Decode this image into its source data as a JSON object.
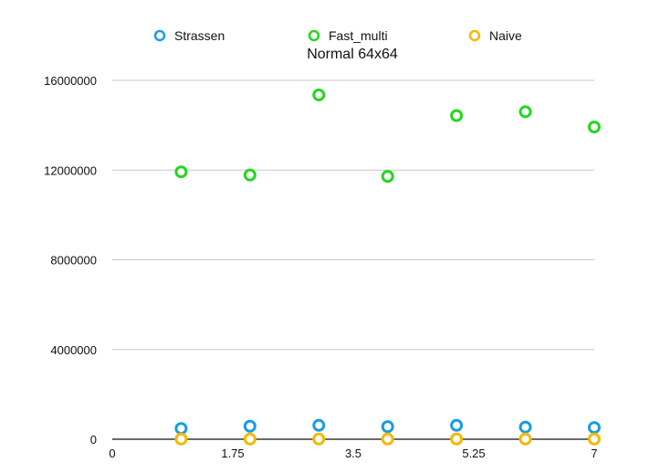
{
  "chart_data": {
    "type": "scatter",
    "title": "Normal 64x64",
    "xlabel": "",
    "ylabel": "",
    "xlim": [
      0,
      7
    ],
    "ylim": [
      0,
      16000000
    ],
    "x_ticks": [
      0,
      1.75,
      3.5,
      5.25,
      7
    ],
    "x_tick_labels": [
      "0",
      "1.75",
      "3.5",
      "5.25",
      "7"
    ],
    "y_ticks": [
      0,
      4000000,
      8000000,
      12000000,
      16000000
    ],
    "y_tick_labels": [
      "0",
      "4000000",
      "8000000",
      "12000000",
      "16000000"
    ],
    "grid": true,
    "legend_position": "top",
    "series": [
      {
        "name": "Strassen",
        "color": "#1a9be6",
        "x": [
          1,
          2,
          3,
          4,
          5,
          6,
          7
        ],
        "y": [
          480000,
          580000,
          620000,
          560000,
          620000,
          540000,
          520000
        ]
      },
      {
        "name": "Fast_multi",
        "color": "#22d71d",
        "x": [
          1,
          2,
          3,
          4,
          5,
          6,
          7
        ],
        "y": [
          11920000,
          11780000,
          15350000,
          11720000,
          14430000,
          14600000,
          13920000
        ]
      },
      {
        "name": "Naive",
        "color": "#f5b800",
        "x": [
          1,
          2,
          3,
          4,
          5,
          6,
          7
        ],
        "y": [
          10000,
          10000,
          10000,
          10000,
          10000,
          10000,
          10000
        ]
      }
    ]
  }
}
